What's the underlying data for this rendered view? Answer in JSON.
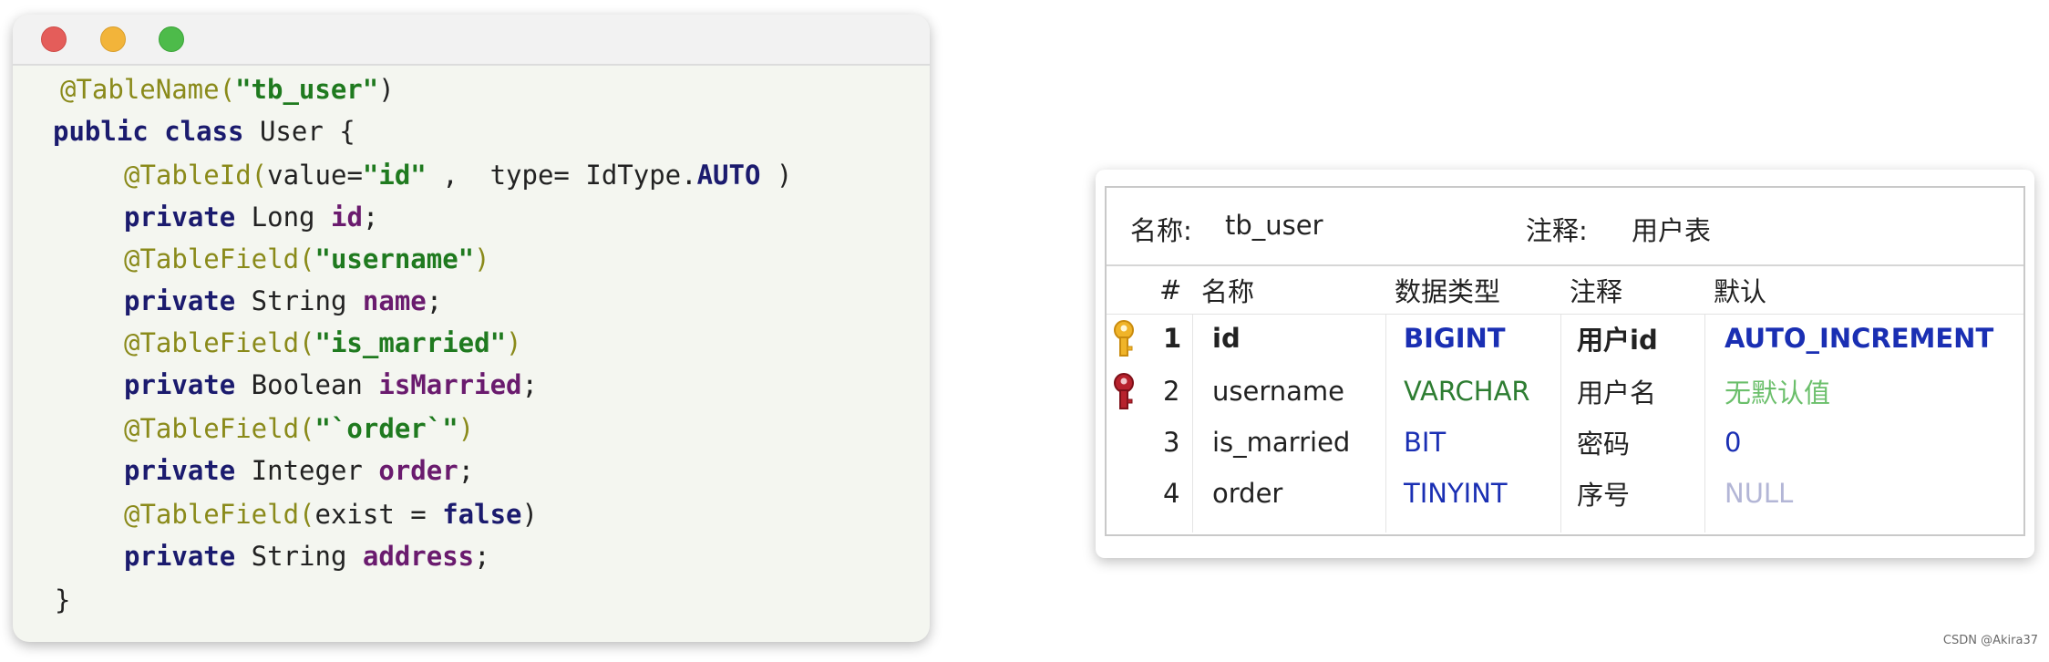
{
  "code": {
    "l1_ann": "@TableName(",
    "l1_str": "\"tb_user\"",
    "l1_end": ")",
    "l2_kw": "public class",
    "l2_rest": " User {",
    "l3_ann": "@TableId(",
    "l3_hint1": "value=",
    "l3_str": "\"id\"",
    "l3_sep": " ,  ",
    "l3_hint2": "type=",
    "l3_val": " IdType.",
    "l3_auto": "AUTO",
    "l3_end": " )",
    "l4_kw": "private",
    "l4_type": " Long ",
    "l4_fld": "id",
    "l4_end": ";",
    "l5_ann": "@TableField(",
    "l5_str": "\"username\"",
    "l5_end": ")",
    "l6_kw": "private",
    "l6_type": " String ",
    "l6_fld": "name",
    "l6_end": ";",
    "l7_ann": "@TableField(",
    "l7_str": "\"is_married\"",
    "l7_end": ")",
    "l8_kw": "private",
    "l8_type": " Boolean ",
    "l8_fld": "isMarried",
    "l8_end": ";",
    "l9_ann": "@TableField(",
    "l9_str": "\"`order`\"",
    "l9_end": ")",
    "l10_kw": "private",
    "l10_type": " Integer ",
    "l10_fld": "order",
    "l10_end": ";",
    "l11_ann": "@TableField(",
    "l11_mid": "exist = ",
    "l11_kw": "false",
    "l11_end": ")",
    "l12_kw": "private",
    "l12_type": " String ",
    "l12_fld": "address",
    "l12_end": ";",
    "l13": "}"
  },
  "table": {
    "name_label": "名称:",
    "name_value": "tb_user",
    "comment_label": "注释:",
    "comment_value": "用户表",
    "headers": [
      "#",
      "名称",
      "数据类型",
      "注释",
      "默认"
    ],
    "rows": [
      {
        "num": "1",
        "name": "id",
        "type": "BIGINT",
        "comment": "用户id",
        "default": "AUTO_INCREMENT"
      },
      {
        "num": "2",
        "name": "username",
        "type": "VARCHAR",
        "comment": "用户名",
        "default": "无默认值"
      },
      {
        "num": "3",
        "name": "is_married",
        "type": "BIT",
        "comment": "密码",
        "default": "0"
      },
      {
        "num": "4",
        "name": "order",
        "type": "TINYINT",
        "comment": "序号",
        "default": "NULL"
      }
    ],
    "icons": [
      "key-gold-icon",
      "key-red-icon"
    ]
  },
  "colors": {
    "window_dot_red": "#e45d5a",
    "window_dot_yellow": "#f2b43a",
    "window_dot_green": "#4dbb4a",
    "keyword": "#1b1b6e",
    "string": "#1f7a1f",
    "annotation": "#8a8a1a",
    "field": "#6a1b6e",
    "type_blue": "#1a2fb3"
  },
  "watermark": "CSDN @Akira37"
}
